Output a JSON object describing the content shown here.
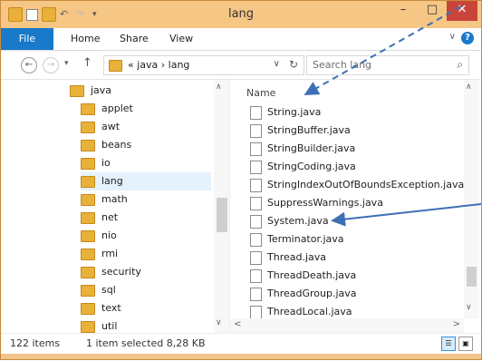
{
  "window": {
    "title": "lang"
  },
  "window_controls": {
    "minimize": "–",
    "maximize": "□",
    "close": "✕"
  },
  "ribbon": {
    "tabs": [
      "File",
      "Home",
      "Share",
      "View"
    ]
  },
  "nav": {
    "breadcrumb": "« java › lang",
    "search_placeholder": "Search lang"
  },
  "tree": {
    "items": [
      {
        "label": "java",
        "selected": false
      },
      {
        "label": "applet",
        "selected": false
      },
      {
        "label": "awt",
        "selected": false
      },
      {
        "label": "beans",
        "selected": false
      },
      {
        "label": "io",
        "selected": false
      },
      {
        "label": "lang",
        "selected": true
      },
      {
        "label": "math",
        "selected": false
      },
      {
        "label": "net",
        "selected": false
      },
      {
        "label": "nio",
        "selected": false
      },
      {
        "label": "rmi",
        "selected": false
      },
      {
        "label": "security",
        "selected": false
      },
      {
        "label": "sql",
        "selected": false
      },
      {
        "label": "text",
        "selected": false
      },
      {
        "label": "util",
        "selected": false
      }
    ]
  },
  "file_list": {
    "column_header": "Name",
    "items": [
      "String.java",
      "StringBuffer.java",
      "StringBuilder.java",
      "StringCoding.java",
      "StringIndexOutOfBoundsException.java",
      "SuppressWarnings.java",
      "System.java",
      "Terminator.java",
      "Thread.java",
      "ThreadDeath.java",
      "ThreadGroup.java",
      "ThreadLocal.java"
    ]
  },
  "status": {
    "item_count": "122 items",
    "selection": "1 item selected  8,28 KB"
  },
  "annotation_colors": {
    "arrow": "#3e6fb5"
  }
}
